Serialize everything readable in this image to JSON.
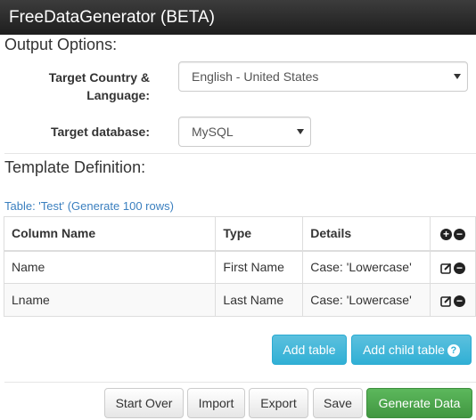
{
  "app": {
    "title": "FreeDataGenerator (BETA)"
  },
  "output_options": {
    "heading": "Output Options:",
    "country_label_line1": "Target Country &",
    "country_label_line2": "Language:",
    "country_value": "English - United States",
    "database_label": "Target database:",
    "database_value": "MySQL"
  },
  "template": {
    "heading": "Template Definition:",
    "table_caption": "Table: 'Test' (Generate 100 rows)",
    "columns": [
      "Column Name",
      "Type",
      "Details"
    ],
    "rows": [
      {
        "name": "Name",
        "type": "First Name",
        "details": "Case: 'Lowercase'"
      },
      {
        "name": "Lname",
        "type": "Last Name",
        "details": "Case: 'Lowercase'"
      }
    ]
  },
  "buttons": {
    "add_table": "Add table",
    "add_child_table": "Add child table",
    "start_over": "Start Over",
    "import": "Import",
    "export": "Export",
    "save": "Save",
    "generate": "Generate Data"
  },
  "icons": {
    "add_column": "plus-circle-icon",
    "remove": "minus-circle-icon",
    "edit": "edit-icon",
    "help": "question-circle-icon"
  },
  "colors": {
    "info": "#5bc0de",
    "success": "#5cb85c",
    "link": "#3a7fbf",
    "titlebar": "#2b2b2b"
  }
}
